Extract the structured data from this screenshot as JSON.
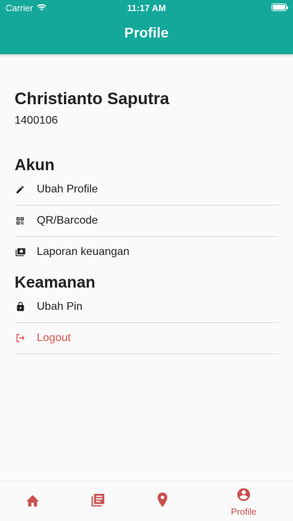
{
  "status_bar": {
    "carrier": "Carrier",
    "time": "11:17 AM"
  },
  "app_bar": {
    "title": "Profile"
  },
  "user": {
    "name": "Christianto Saputra",
    "id": "1400106"
  },
  "sections": {
    "account": {
      "title": "Akun",
      "items": [
        {
          "label": "Ubah Profile",
          "icon": "pencil-icon"
        },
        {
          "label": "QR/Barcode",
          "icon": "qr-code-icon"
        },
        {
          "label": "Laporan keuangan",
          "icon": "money-report-icon"
        }
      ]
    },
    "security": {
      "title": "Keamanan",
      "items": [
        {
          "label": "Ubah Pin",
          "icon": "lock-icon"
        },
        {
          "label": "Logout",
          "icon": "logout-icon"
        }
      ]
    }
  },
  "bottom_nav": {
    "items": [
      {
        "icon": "home-icon",
        "label": ""
      },
      {
        "icon": "news-icon",
        "label": ""
      },
      {
        "icon": "location-pin-icon",
        "label": ""
      },
      {
        "icon": "profile-icon",
        "label": "Profile"
      }
    ],
    "active_index": 3
  },
  "colors": {
    "primary": "#13a89a",
    "accent_red": "#c94f4f",
    "logout_red": "#d9534f",
    "text": "#222222",
    "background": "#fafafa"
  }
}
